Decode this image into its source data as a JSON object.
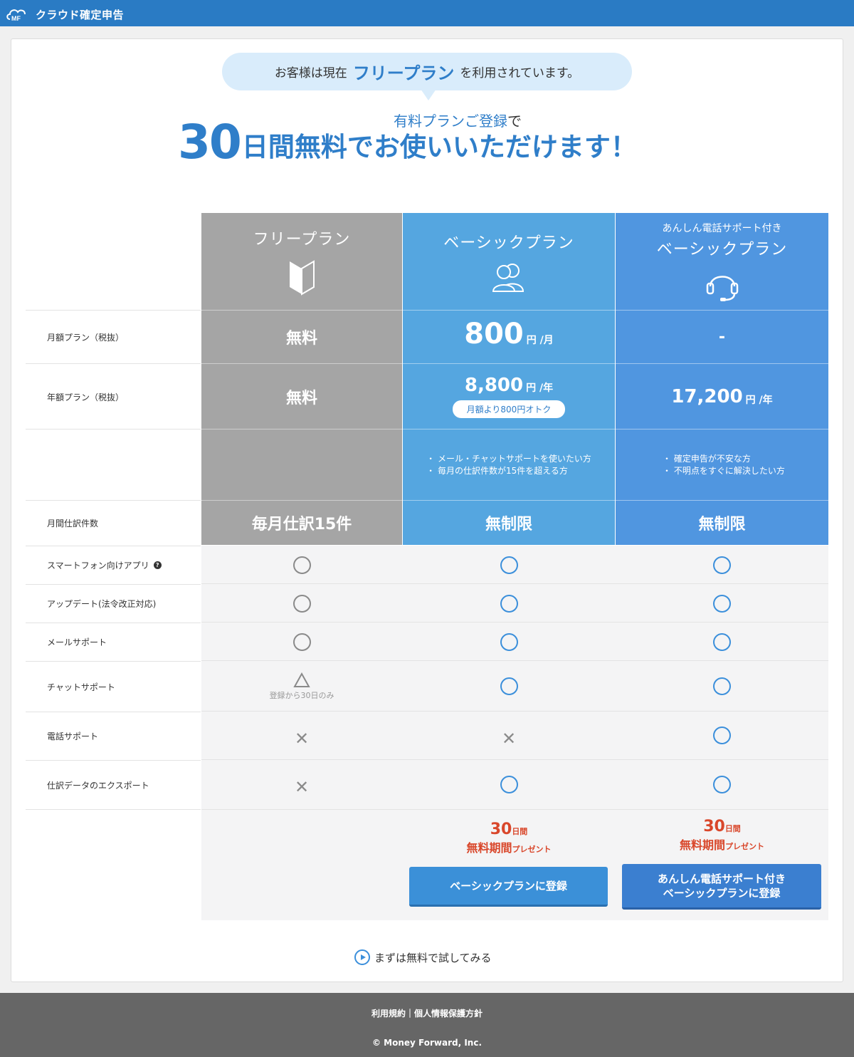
{
  "app": {
    "logo_text": "クラウド確定申告",
    "logo_mark": "MF"
  },
  "banner": {
    "prefix": "お客様は現在",
    "plan": "フリープラン",
    "suffix": "を利用されています。"
  },
  "headline": {
    "sub": "有料プランご登録",
    "sub_de": "で",
    "big": "30",
    "rest": "日間無料でお使いいただけます！"
  },
  "plans": {
    "free": {
      "name": "フリープラン",
      "icon": "beginner-mark-icon"
    },
    "basic": {
      "name": "ベーシックプラン",
      "icon": "users-icon"
    },
    "anshin": {
      "name_small": "あんしん電話サポート付き",
      "name": "ベーシックプラン",
      "icon": "headset-icon"
    }
  },
  "rows": {
    "monthly": {
      "label": "月額プラン（税抜）",
      "free": "無料",
      "basic_price": "800",
      "basic_unit": "円 /月",
      "anshin": "-"
    },
    "yearly": {
      "label": "年額プラン（税抜）",
      "free": "無料",
      "basic_price": "8,800",
      "basic_unit": "円 /年",
      "basic_note": "月額より800円オトク",
      "anshin_price": "17,200",
      "anshin_unit": "円 /年"
    },
    "target": {
      "basic": [
        "・ メール・チャットサポートを使いたい方",
        "・ 毎月の仕訳件数が15件を超える方"
      ],
      "anshin": [
        "・ 確定申告が不安な方",
        "・ 不明点をすぐに解決したい方"
      ]
    },
    "journal": {
      "label": "月間仕訳件数",
      "free": "毎月仕訳15件",
      "basic": "無制限",
      "anshin": "無制限"
    }
  },
  "features": [
    {
      "label": "スマートフォン向けアプリ",
      "free": "circle",
      "basic": "circle",
      "anshin": "circle"
    },
    {
      "label": "アップデート(法令改正対応)",
      "free": "circle",
      "basic": "circle",
      "anshin": "circle"
    },
    {
      "label": "メールサポート",
      "free": "circle",
      "basic": "circle",
      "anshin": "circle"
    },
    {
      "label": "チャットサポート",
      "free": "triangle",
      "free_note": "登録から30日のみ",
      "basic": "circle",
      "anshin": "circle"
    },
    {
      "label": "電話サポート",
      "free": "cross",
      "basic": "cross",
      "anshin": "circle"
    },
    {
      "label": "仕訳データのエクスポート",
      "free": "cross",
      "basic": "circle",
      "anshin": "circle"
    }
  ],
  "promo": {
    "num": "30",
    "unit": "日間",
    "line2": "無料期間",
    "line2_small": "プレゼント"
  },
  "buttons": {
    "basic": "ベーシックプランに登録",
    "anshin_line1": "あんしん電話サポート付き",
    "anshin_line2": "ベーシックプランに登録"
  },
  "try_free": "まずは無料で試してみる",
  "footer": {
    "links": "利用規約｜個人情報保護方針",
    "copyright": "© Money Forward, Inc."
  },
  "colors": {
    "header": "#2a7bc4",
    "free_col": "#a5a5a5",
    "basic_col": "#55a6e0",
    "anshin_col": "#5096e0",
    "promo": "#d9472b"
  }
}
